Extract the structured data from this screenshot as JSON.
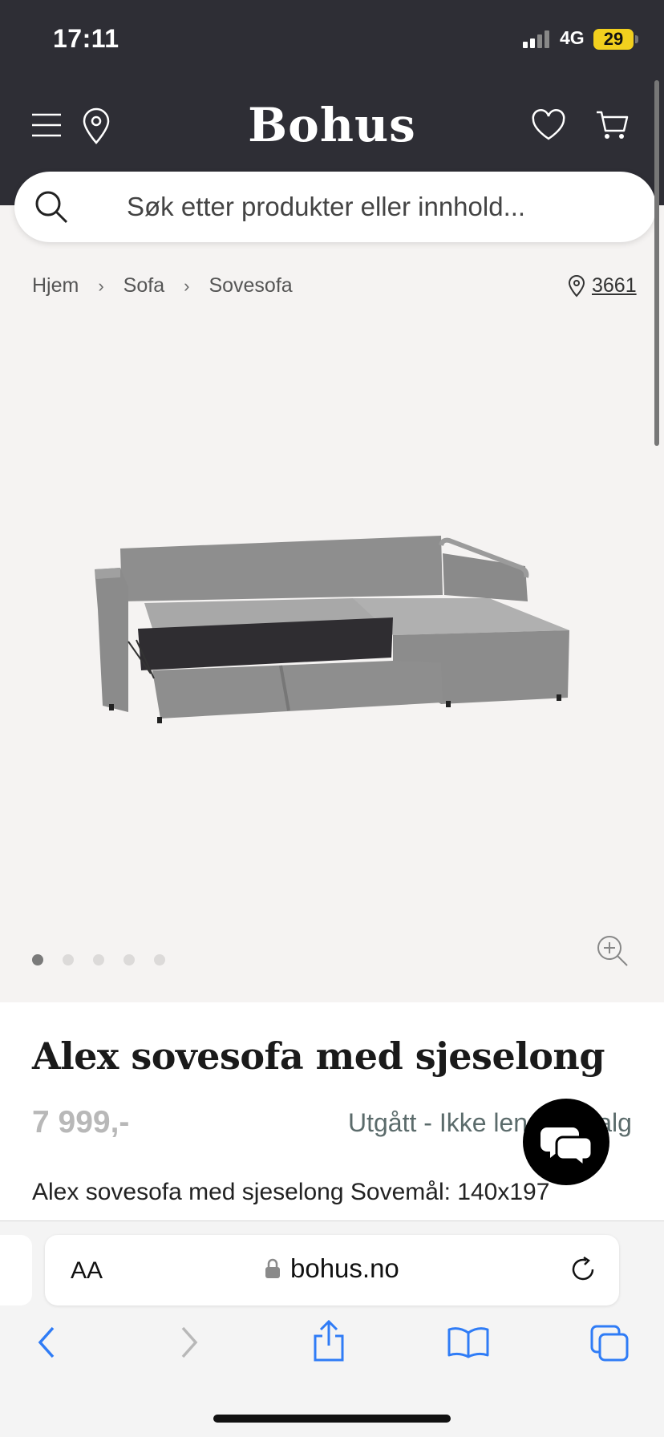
{
  "status_bar": {
    "time": "17:11",
    "network": "4G",
    "battery": "29"
  },
  "header": {
    "logo": "Bohus"
  },
  "search": {
    "placeholder": "Søk etter produkter eller innhold..."
  },
  "breadcrumb": {
    "items": [
      "Hjem",
      "Sofa",
      "Sovesofa"
    ]
  },
  "store": {
    "number": "3661"
  },
  "gallery": {
    "image_count": 5,
    "active_index": 0
  },
  "product": {
    "title": "Alex sovesofa med sjeselong",
    "price": "7 999,-",
    "availability": "Utgått - Ikke lengre i salg",
    "description": "Alex sovesofa med sjeselong Sovemål: 140x197"
  },
  "browser": {
    "text_size": "AA",
    "url": "bohus.no"
  },
  "colors": {
    "header_bg": "#2e2e35",
    "page_bg": "#f5f3f2",
    "price": "#b8b8b8",
    "availability": "#5b6b6b",
    "battery": "#f2d01e"
  }
}
